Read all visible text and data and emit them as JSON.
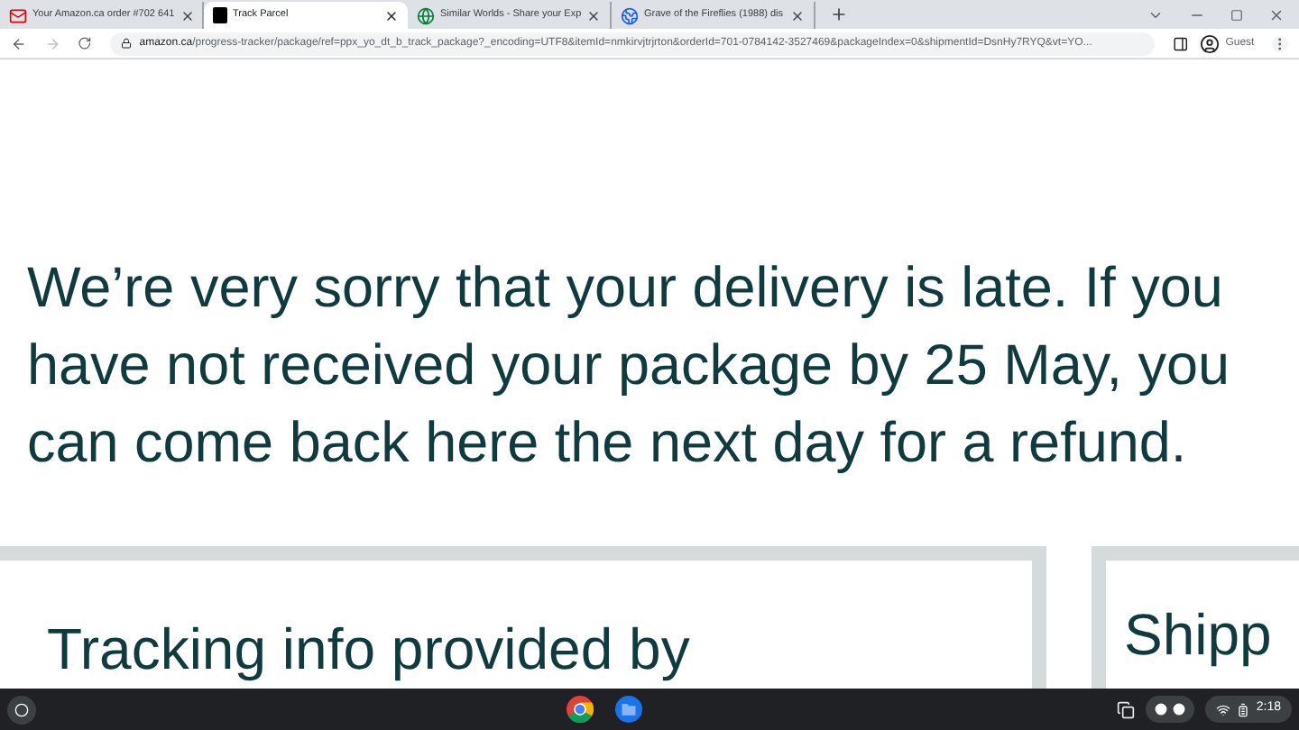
{
  "browser": {
    "tabs": [
      {
        "title": "Your Amazon.ca order #702 641",
        "selected": false
      },
      {
        "title": "Track Parcel",
        "selected": true
      },
      {
        "title": "Similar Worlds - Share your Exp",
        "selected": false
      },
      {
        "title": "Grave of the Fireflies (1988) dis",
        "selected": false
      }
    ],
    "url_domain": "amazon.ca",
    "url_path": "/progress-tracker/package/ref=ppx_yo_dt_b_track_package?_encoding=UTF8&itemId=nmkirvjtrjrton&orderId=701-0784142-3527469&packageIndex=0&shipmentId=DsnHy7RYQ&vt=YO...",
    "profile": "Guest"
  },
  "page": {
    "message": "We’re very sorry that your delivery is late. If you have not received your package by 25 May, you can come back here the next day for a refund.",
    "cards": [
      {
        "heading": "Tracking info provided by"
      },
      {
        "heading": "Shipp"
      }
    ]
  },
  "taskbar": {
    "time": "2:18"
  }
}
